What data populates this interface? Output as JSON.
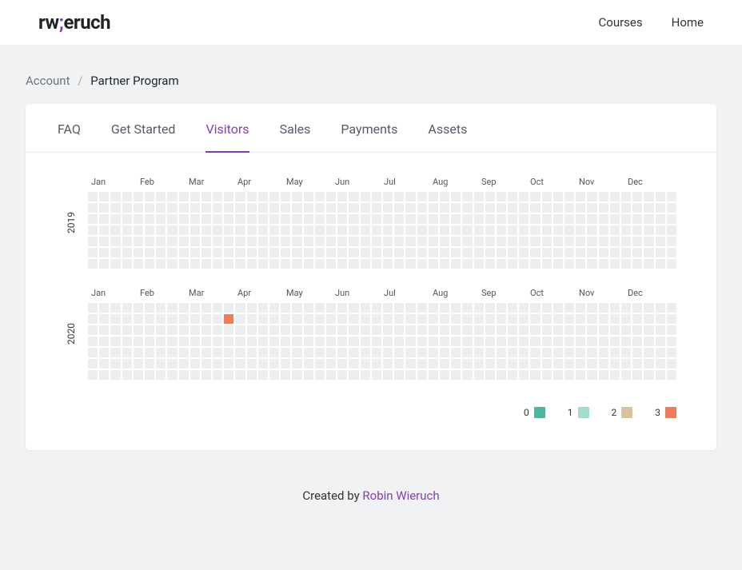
{
  "header": {
    "logo_pre": "rw",
    "logo_accent": ";",
    "logo_post": "eruch",
    "nav": {
      "courses": "Courses",
      "home": "Home"
    }
  },
  "breadcrumb": {
    "account": "Account",
    "sep": "/",
    "current": "Partner Program"
  },
  "tabs": {
    "faq": "FAQ",
    "get_started": "Get Started",
    "visitors": "Visitors",
    "sales": "Sales",
    "payments": "Payments",
    "assets": "Assets",
    "active": "visitors"
  },
  "chart_data": [
    {
      "type": "heatmap",
      "year": "2019",
      "weeks": 52,
      "rows": 7,
      "months": [
        "Jan",
        "Feb",
        "Mar",
        "Apr",
        "May",
        "Jun",
        "Jul",
        "Aug",
        "Sep",
        "Oct",
        "Nov",
        "Dec"
      ],
      "highlights": []
    },
    {
      "type": "heatmap",
      "year": "2020",
      "weeks": 52,
      "rows": 7,
      "months": [
        "Jan",
        "Feb",
        "Mar",
        "Apr",
        "May",
        "Jun",
        "Jul",
        "Aug",
        "Sep",
        "Oct",
        "Nov",
        "Dec"
      ],
      "highlights": [
        {
          "week": 12,
          "day": 1,
          "level": 3
        }
      ]
    }
  ],
  "legend": [
    {
      "label": "0",
      "color": "#4db6a2"
    },
    {
      "label": "1",
      "color": "#a3dbcf"
    },
    {
      "label": "2",
      "color": "#d9c2a0"
    },
    {
      "label": "3",
      "color": "#ee7c5c"
    }
  ],
  "footer": {
    "prefix": "Created by ",
    "author": "Robin Wieruch"
  }
}
